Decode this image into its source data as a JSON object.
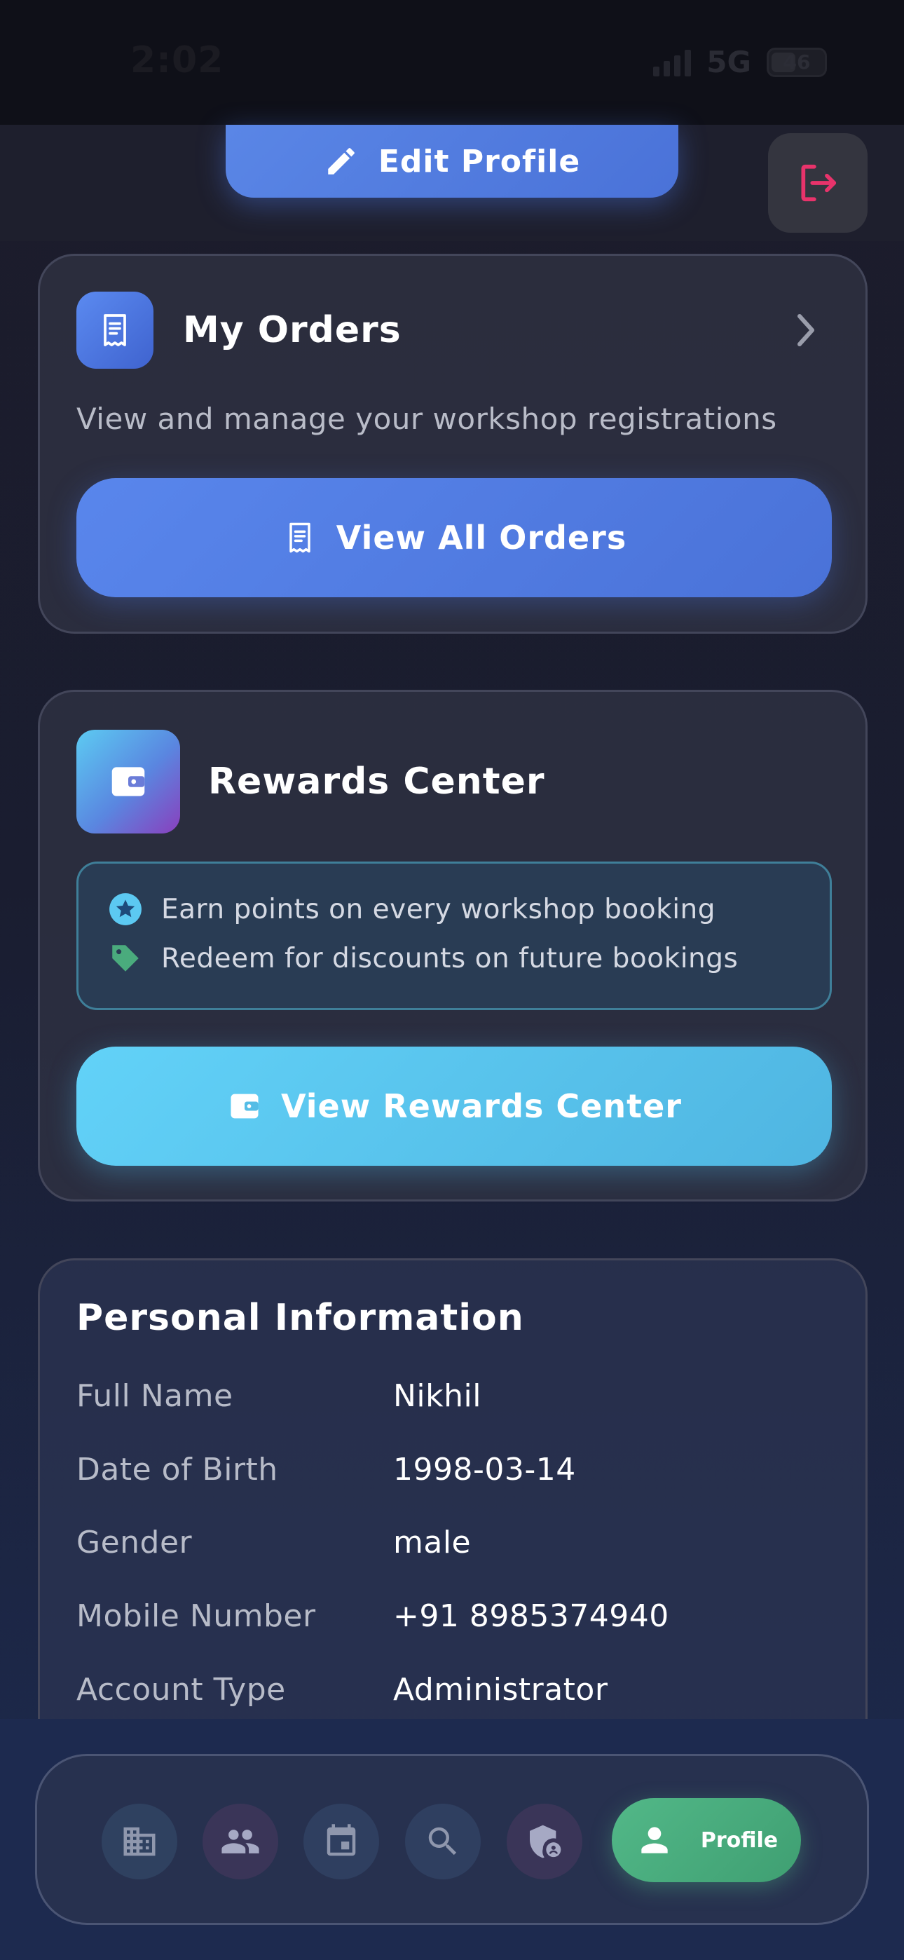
{
  "status_bar": {
    "time": "2:02",
    "network": "5G",
    "battery": "46"
  },
  "header": {
    "edit_profile_label": "Edit Profile",
    "logout_icon": "logout-icon"
  },
  "orders": {
    "title": "My Orders",
    "description": "View and manage your workshop registrations",
    "button_label": "View All Orders",
    "icon": "receipt-icon"
  },
  "rewards": {
    "title": "Rewards Center",
    "perks": [
      {
        "icon": "star-badge-icon",
        "text": "Earn points on every workshop booking"
      },
      {
        "icon": "tag-icon",
        "text": "Redeem for discounts on future bookings"
      }
    ],
    "button_label": "View Rewards Center",
    "icon": "wallet-icon"
  },
  "personal_info": {
    "title": "Personal Information",
    "rows": [
      {
        "label": "Full Name",
        "value": "Nikhil"
      },
      {
        "label": "Date of Birth",
        "value": "1998-03-14"
      },
      {
        "label": "Gender",
        "value": "male"
      },
      {
        "label": "Mobile Number",
        "value": "+91 8985374940"
      },
      {
        "label": "Account Type",
        "value": "Administrator"
      }
    ]
  },
  "tab_bar": {
    "tabs": [
      {
        "icon": "building-icon"
      },
      {
        "icon": "people-icon"
      },
      {
        "icon": "calendar-icon"
      },
      {
        "icon": "search-icon"
      },
      {
        "icon": "admin-shield-icon"
      }
    ],
    "active": {
      "icon": "person-icon",
      "label": "Profile"
    }
  },
  "colors": {
    "primary_blue": "#4a72d8",
    "rewards_cyan": "#5cc9f2",
    "active_green": "#4aab7d",
    "logout_red": "#e8336b"
  }
}
